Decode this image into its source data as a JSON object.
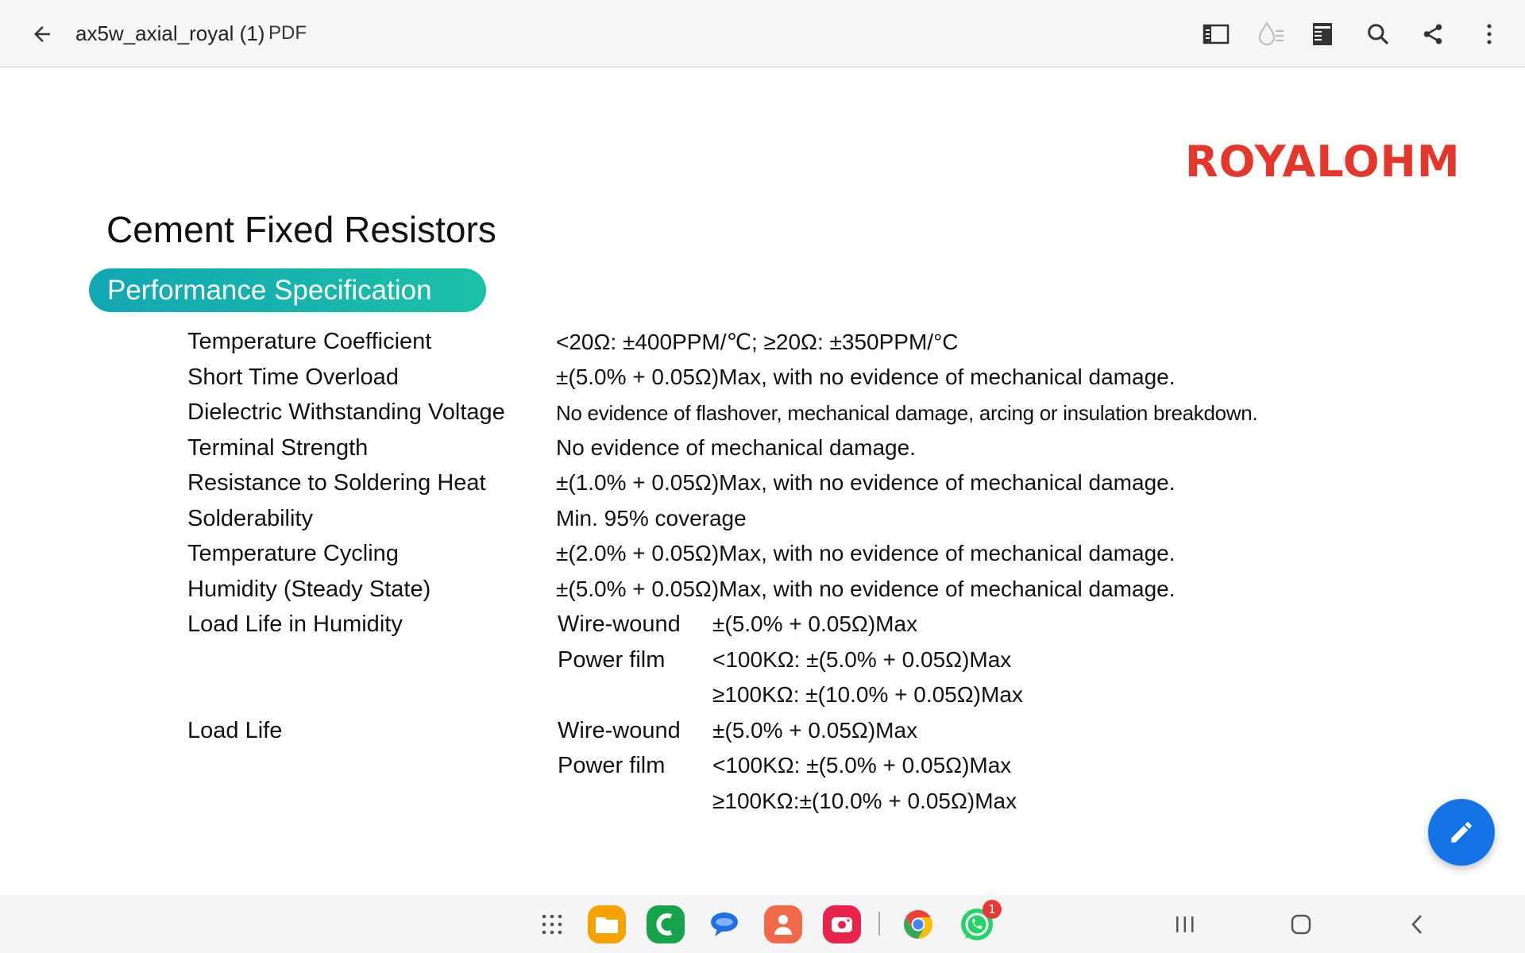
{
  "appbar": {
    "doc_title": "ax5w_axial_royal (1)",
    "doc_type": "PDF",
    "icons": [
      "back-arrow-icon",
      "panel-view-icon",
      "liquid-mode-icon",
      "reading-mode-icon",
      "search-icon",
      "share-icon",
      "more-vert-icon"
    ]
  },
  "document": {
    "logo_text": "ROYALOHM",
    "title": "Cement Fixed Resistors",
    "section": "Performance Specification",
    "specs": [
      {
        "label": "Temperature Coefficient",
        "value": "<20Ω: ±400PPM/℃; ≥20Ω: ±350PPM/°C"
      },
      {
        "label": "Short Time Overload",
        "value": "±(5.0% + 0.05Ω)Max, with no evidence of mechanical damage."
      },
      {
        "label": "Dielectric Withstanding Voltage",
        "value": "No evidence of flashover, mechanical damage, arcing or insulation breakdown."
      },
      {
        "label": "Terminal Strength",
        "value": "No evidence of mechanical damage."
      },
      {
        "label": "Resistance to Soldering Heat",
        "value": "±(1.0% + 0.05Ω)Max, with no evidence of mechanical damage."
      },
      {
        "label": "Solderability",
        "value": "Min. 95% coverage"
      },
      {
        "label": "Temperature Cycling",
        "value": "±(2.0% + 0.05Ω)Max, with no evidence of mechanical damage."
      },
      {
        "label": "Humidity (Steady State)",
        "value": "±(5.0% + 0.05Ω)Max, with no evidence of mechanical damage."
      }
    ],
    "load_life_humidity": {
      "label": "Load Life in Humidity",
      "wire_label": "Wire-wound",
      "wire_value": "±(5.0% + 0.05Ω)Max",
      "film_label": "Power film",
      "film_value_1": "<100KΩ: ±(5.0% + 0.05Ω)Max",
      "film_value_2": "≥100KΩ: ±(10.0% + 0.05Ω)Max"
    },
    "load_life": {
      "label": "Load Life",
      "wire_label": "Wire-wound",
      "wire_value": "±(5.0% + 0.05Ω)Max",
      "film_label": "Power film",
      "film_value_1": "<100KΩ: ±(5.0% + 0.05Ω)Max",
      "film_value_2": "≥100KΩ:±(10.0% + 0.05Ω)Max"
    }
  },
  "fab": {
    "icon": "pencil-icon",
    "color": "#1473e6"
  },
  "taskbar": {
    "apps": [
      "app-drawer-icon",
      "my-files-icon",
      "phone-icon",
      "messages-icon",
      "contacts-icon",
      "screen-recorder-icon",
      "chrome-icon",
      "whatsapp-icon"
    ],
    "whatsapp_badge": "1",
    "nav": [
      "recents-icon",
      "home-icon",
      "back-icon"
    ]
  },
  "colors": {
    "accent_red": "#e2372a",
    "pill_start": "#12a7b3",
    "pill_end": "#1cc0a7",
    "fab_blue": "#1473e6"
  }
}
